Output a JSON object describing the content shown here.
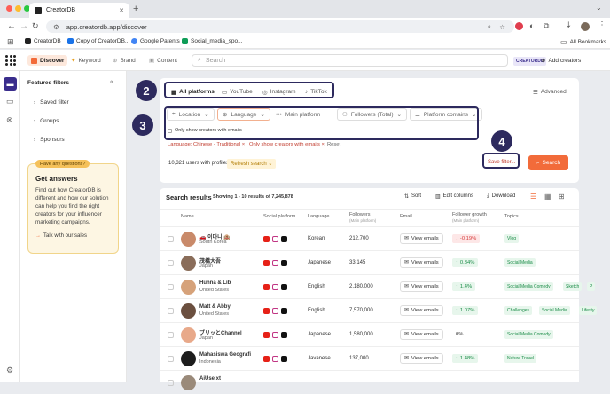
{
  "browser": {
    "tab_title": "CreatorDB",
    "url": "app.creatordb.app/discover",
    "bookmarks": [
      "CreatorDB",
      "Copy of CreatorDB...",
      "Google Patents",
      "Social_media_spo..."
    ],
    "all_bookmarks": "All Bookmarks"
  },
  "header": {
    "discover": "Discover",
    "keyword": "Keyword",
    "brand": "Brand",
    "content": "Content",
    "search_placeholder": "Search",
    "creatordb_badge": "CREATORDB",
    "add_creators": "Add creators"
  },
  "sidebar": {
    "title": "Featured filters",
    "items": [
      "Saved filter",
      "Groups",
      "Sponsors"
    ],
    "promo": {
      "badge": "Have any questions?",
      "heading": "Get answers",
      "body": "Find out how CreatorDB is different and how our solution can help you find the right creators for your influencer marketing campaigns.",
      "link": "Talk with our sales"
    }
  },
  "filters": {
    "tabs": [
      "All platforms",
      "YouTube",
      "Instagram",
      "TikTok"
    ],
    "advanced": "Advanced",
    "fields": [
      "Location",
      "Language",
      "Main platform",
      "Followers (Total)",
      "Platform contains"
    ],
    "email_checkbox": "Only show creators with emails",
    "chips": [
      "Language: Chinese - Traditional ×",
      "Only show creators with emails ×"
    ],
    "reset": "Reset",
    "count": "10,321 users with profiles",
    "refresh": "Refresh search",
    "save_filter": "Save filter...",
    "search_button": "Search"
  },
  "callouts": [
    "2",
    "3",
    "4"
  ],
  "results": {
    "title": "Search results",
    "showing": "Showing 1 - 10 results of 7,245,878",
    "sort": "Sort",
    "edit_columns": "Edit columns",
    "download": "Download",
    "columns": {
      "name": "Name",
      "social": "Social platform",
      "language": "Language",
      "followers": "Followers",
      "followers_sub": "(Main platform)",
      "email": "Email",
      "growth": "Follower growth",
      "growth_sub": "(Main platform)",
      "topics": "Topics"
    },
    "rows": [
      {
        "name": "🚗 이마니 🏨",
        "country": "South Korea",
        "language": "Korean",
        "followers": "212,700",
        "email": "View emails",
        "growth": "-0.19%",
        "growth_dir": "down",
        "topics": [
          "Vlog"
        ],
        "avatar": "#c98a6a"
      },
      {
        "name": "茂橋大吾",
        "country": "Japan",
        "language": "Japanese",
        "followers": "33,145",
        "email": "View emails",
        "growth": "0.34%",
        "growth_dir": "up",
        "topics": [
          "Social Media"
        ],
        "avatar": "#8a6d5a"
      },
      {
        "name": "Hunna & Lib",
        "country": "United States",
        "language": "English",
        "followers": "2,180,000",
        "email": "View emails",
        "growth": "1.4%",
        "growth_dir": "up",
        "topics": [
          "Social Media Comedy",
          "Sketch",
          "P"
        ],
        "avatar": "#d6a27a"
      },
      {
        "name": "Matt & Abby",
        "country": "United States",
        "language": "English",
        "followers": "7,570,000",
        "email": "View emails",
        "growth": "1.07%",
        "growth_dir": "up",
        "topics": [
          "Challenges",
          "Social Media",
          "Lifesty"
        ],
        "avatar": "#6b4f3f"
      },
      {
        "name": "ブリッとChannel",
        "country": "Japan",
        "language": "Japanese",
        "followers": "1,580,000",
        "email": "View emails",
        "growth": "0%",
        "growth_dir": "flat",
        "topics": [
          "Social Media Comedy"
        ],
        "avatar": "#e8a98a"
      },
      {
        "name": "Mahasiswa Geografi",
        "country": "Indonesia",
        "language": "Javanese",
        "followers": "137,000",
        "email": "View emails",
        "growth": "1.48%",
        "growth_dir": "up",
        "topics": [
          "Nature Travel"
        ],
        "avatar": "#1d1d1d"
      },
      {
        "name": "AiUse xt",
        "country": "",
        "language": "",
        "followers": "",
        "email": "",
        "growth": "",
        "growth_dir": "none",
        "topics": [],
        "avatar": "#9a8a7a"
      }
    ]
  },
  "colors": {
    "accent": "#f26b3a",
    "callout": "#2d2a5e",
    "green": "#1a8c47",
    "red": "#d63a3a",
    "brand_purple": "#3a2d8c"
  }
}
